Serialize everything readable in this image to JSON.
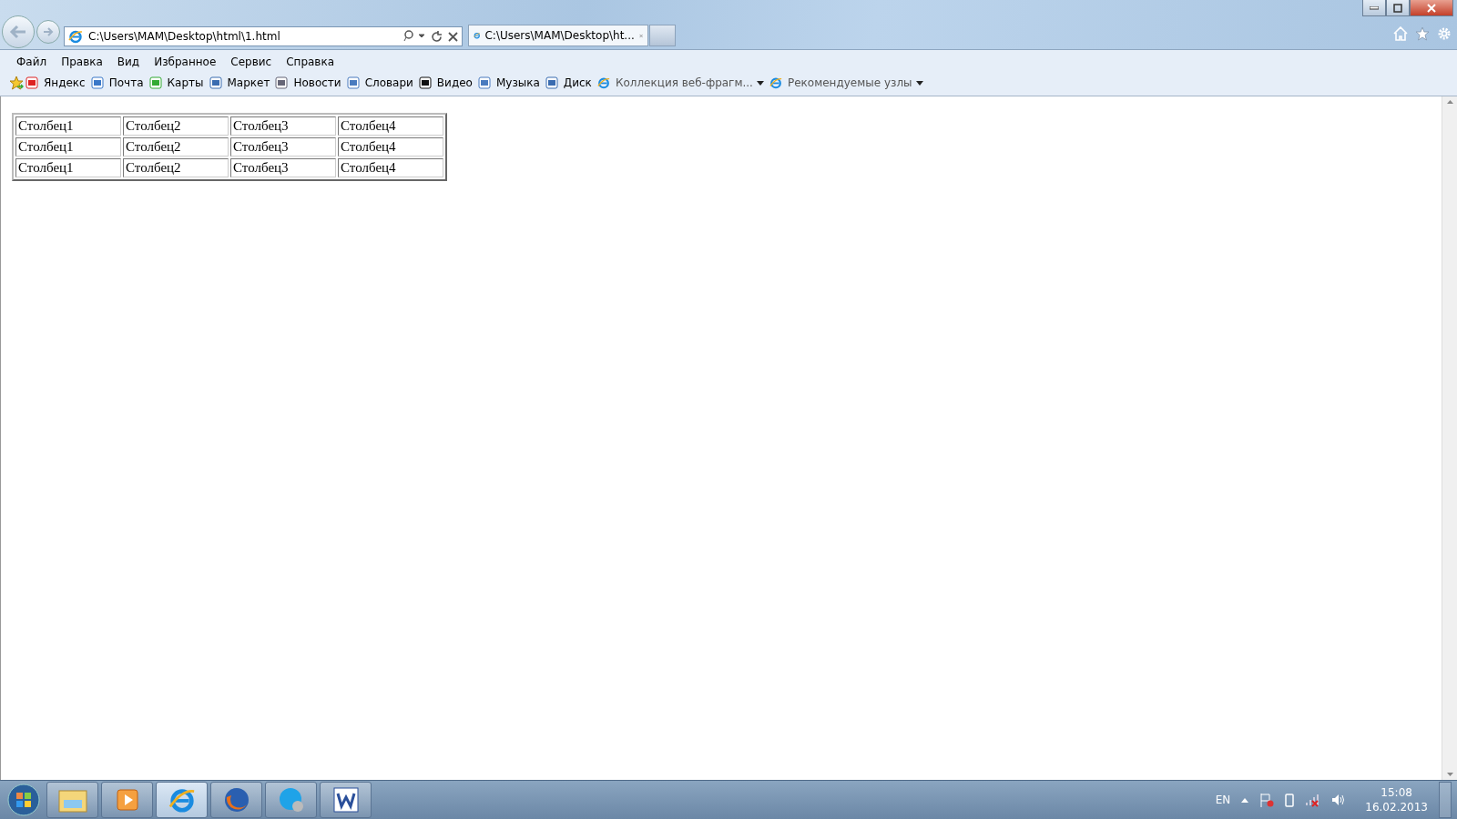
{
  "browser": {
    "address": "C:\\Users\\MAM\\Desktop\\html\\1.html",
    "tabs": [
      {
        "title": "C:\\Users\\MAM\\Desktop\\ht...",
        "selected": true
      }
    ]
  },
  "menu": [
    "Файл",
    "Правка",
    "Вид",
    "Избранное",
    "Сервис",
    "Справка"
  ],
  "favorites": [
    {
      "label": "Яндекс",
      "dropdown": false
    },
    {
      "label": "Почта",
      "dropdown": false
    },
    {
      "label": "Карты",
      "dropdown": false
    },
    {
      "label": "Маркет",
      "dropdown": false
    },
    {
      "label": "Новости",
      "dropdown": false
    },
    {
      "label": "Словари",
      "dropdown": false
    },
    {
      "label": "Видео",
      "dropdown": false
    },
    {
      "label": "Музыка",
      "dropdown": false
    },
    {
      "label": "Диск",
      "dropdown": false
    },
    {
      "label": "Коллекция веб-фрагм...",
      "dropdown": true
    },
    {
      "label": "Рекомендуемые узлы",
      "dropdown": true
    }
  ],
  "table": {
    "rows": [
      [
        "Столбец1",
        "Столбец2",
        "Столбец3",
        "Столбец4"
      ],
      [
        "Столбец1",
        "Столбец2",
        "Столбец3",
        "Столбец4"
      ],
      [
        "Столбец1",
        "Столбец2",
        "Столбец3",
        "Столбец4"
      ]
    ]
  },
  "taskbar": {
    "language": "EN",
    "time": "15:08",
    "date": "16.02.2013"
  }
}
